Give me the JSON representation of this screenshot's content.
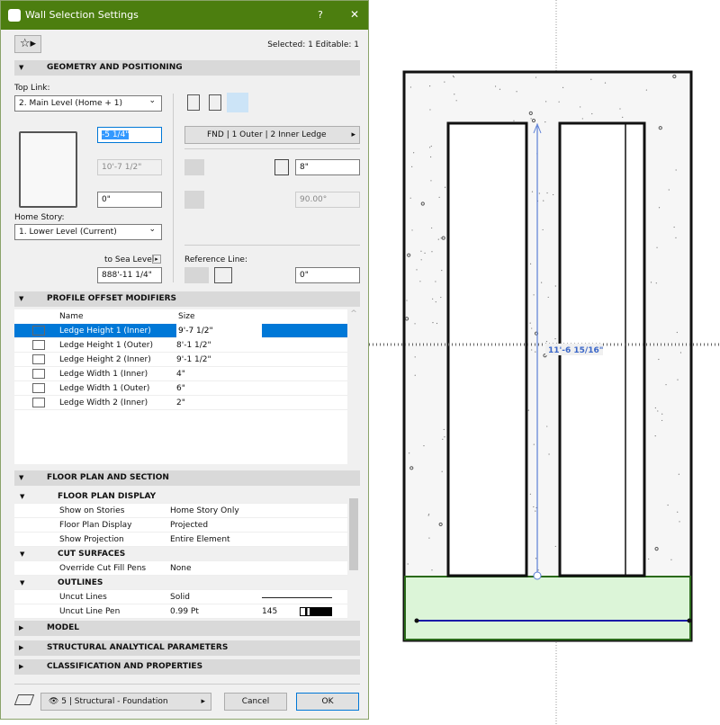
{
  "dialog": {
    "title": "Wall Selection Settings",
    "help": "?",
    "close": "✕",
    "selection_info": "Selected: 1 Editable: 1"
  },
  "geometry": {
    "header": "GEOMETRY AND POSITIONING",
    "top_link_label": "Top Link:",
    "top_link_value": "2. Main Level (Home + 1)",
    "top_offset": "-5 1/4\"",
    "height": "10'-7 1/2\"",
    "bottom_offset": "0\"",
    "home_story_label": "Home Story:",
    "home_story_value": "1. Lower Level (Current)",
    "sea_level_label": "to Sea Level",
    "sea_level_value": "888'-11 1/4\"",
    "profile": "FND | 1 Outer | 2 Inner Ledge",
    "thickness": "8\"",
    "angle": "90.00°",
    "reference_line_label": "Reference Line:",
    "ref_offset": "0\""
  },
  "profile_offset": {
    "header": "PROFILE OFFSET MODIFIERS",
    "columns": [
      "Name",
      "Size"
    ],
    "rows": [
      {
        "name": "Ledge Height 1 (Inner)",
        "size": "9'-7 1/2\"",
        "selected": true
      },
      {
        "name": "Ledge Height 1 (Outer)",
        "size": "8'-1 1/2\""
      },
      {
        "name": "Ledge Height 2 (Inner)",
        "size": "9'-1 1/2\""
      },
      {
        "name": "Ledge Width 1 (Inner)",
        "size": "4\""
      },
      {
        "name": "Ledge Width 1 (Outer)",
        "size": "6\""
      },
      {
        "name": "Ledge Width 2 (Inner)",
        "size": "2\""
      }
    ]
  },
  "floor_plan": {
    "header": "FLOOR PLAN AND SECTION",
    "groups": [
      "FLOOR PLAN DISPLAY",
      "CUT SURFACES",
      "OUTLINES"
    ],
    "rows": [
      {
        "name": "Show on Stories",
        "value": "Home Story Only"
      },
      {
        "name": "Floor Plan Display",
        "value": "Projected"
      },
      {
        "name": "Show Projection",
        "value": "Entire Element"
      },
      {
        "name": "Override Cut Fill Pens",
        "value": "None"
      },
      {
        "name": "Uncut Lines",
        "value": "Solid"
      },
      {
        "name": "Uncut Line Pen",
        "value": "0.99 Pt",
        "pen": "145"
      }
    ]
  },
  "sections": [
    "MODEL",
    "STRUCTURAL ANALYTICAL PARAMETERS",
    "CLASSIFICATION AND PROPERTIES"
  ],
  "footer": {
    "layer": "5 | Structural - Foundation",
    "cancel": "Cancel",
    "ok": "OK"
  },
  "canvas": {
    "dimension": "11'-6 15/16\"",
    "colors": {
      "fill_green": "#dcf5d8",
      "dimension_blue": "#5b7fd6",
      "ref_line": "#1a1aa8"
    }
  }
}
